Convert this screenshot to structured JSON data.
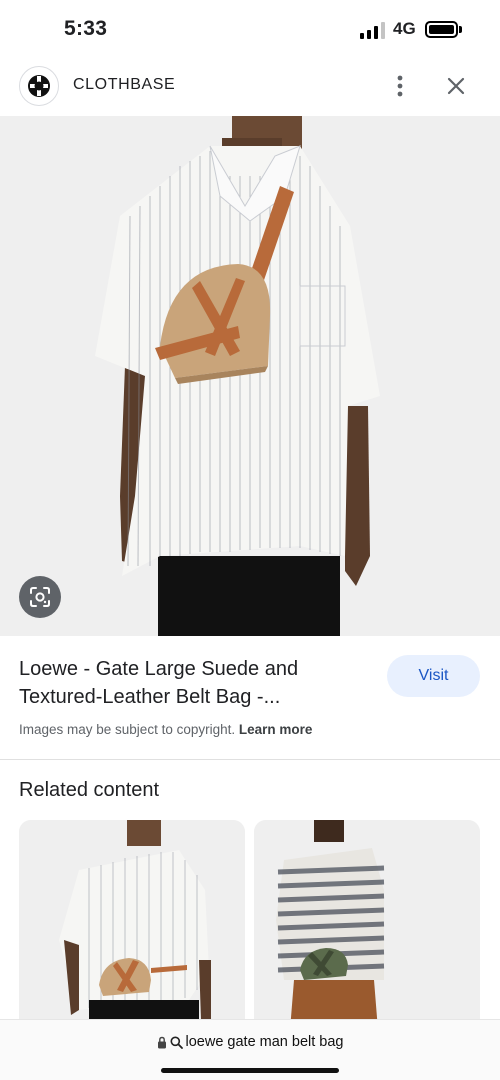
{
  "status_bar": {
    "time": "5:33",
    "network": "4G",
    "signal_bars_active": 3,
    "signal_bars_total": 4
  },
  "site": {
    "name": "CLOTHBASE",
    "logo_icon": "clothbase-logo-icon",
    "more_icon": "more-vertical-icon",
    "close_icon": "close-icon"
  },
  "main_image": {
    "lens_icon": "lens-search-icon"
  },
  "result": {
    "title_line1": "Loewe - Gate Large Suede and",
    "title_line2": "Textured-Leather Belt Bag -...",
    "visit_label": "Visit",
    "copyright_text": "Images may be subject to copyright.",
    "learn_more": "Learn more"
  },
  "related": {
    "heading": "Related content"
  },
  "url_bar": {
    "lock_icon": "lock-icon",
    "search_icon": "search-icon",
    "query": "loewe gate man belt bag"
  },
  "colors": {
    "visit_bg": "#e8f0fe",
    "visit_text": "#1a56c4",
    "bag_tan": "#c9a47a",
    "strap_brown": "#b86a3a"
  }
}
